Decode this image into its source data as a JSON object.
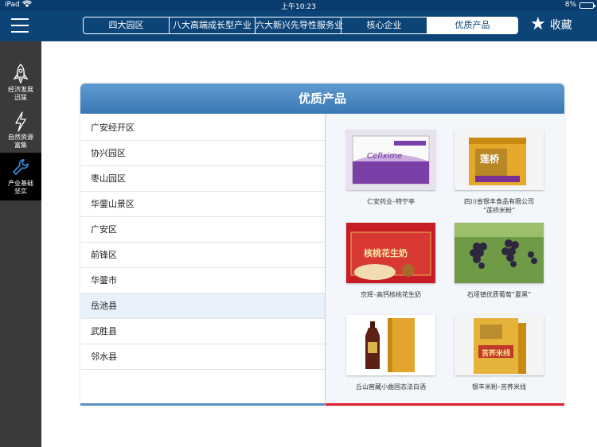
{
  "status_bar": {
    "carrier": "iPad",
    "time": "上午10:23",
    "battery": "8%"
  },
  "nav": {
    "tabs": [
      "四大园区",
      "八大高端成长型产业",
      "六大新兴先导性服务业",
      "核心企业",
      "优质产品"
    ],
    "active_tab": "优质产品",
    "favorite_label": "收藏"
  },
  "sidebar": {
    "items": [
      {
        "label_line1": "经济发展",
        "label_line2": "迅猛",
        "icon": "rocket-icon"
      },
      {
        "label_line1": "自然资源",
        "label_line2": "富集",
        "icon": "lightning-icon"
      },
      {
        "label_line1": "产业基础",
        "label_line2": "坚实",
        "icon": "wrench-icon"
      }
    ]
  },
  "card": {
    "title": "优质产品",
    "regions": [
      "广安经开区",
      "协兴园区",
      "枣山园区",
      "华蓥山景区",
      "广安区",
      "前锋区",
      "华蓥市",
      "岳池县",
      "武胜县",
      "邻水县"
    ],
    "selected_region": "岳池县",
    "products": [
      {
        "caption_line1": "仁安药业–特宁亭",
        "caption_line2": "",
        "box_text": "Cefixime"
      },
      {
        "caption_line1": "四川省银丰食品有限公司",
        "caption_line2": "“莲桥米粉”",
        "box_text": "莲桥"
      },
      {
        "caption_line1": "京辉–高钙核桃花生奶",
        "caption_line2": "",
        "box_text": "核桃花生奶"
      },
      {
        "caption_line1": "石垭镇优质葡萄“夏黑”",
        "caption_line2": "",
        "box_text": ""
      },
      {
        "caption_line1": "丘山窖藏小曲固态法白酒",
        "caption_line2": "",
        "box_text": ""
      },
      {
        "caption_line1": "银丰米粉–苦荞米线",
        "caption_line2": "",
        "box_text": "苦荞米线"
      }
    ]
  },
  "colors": {
    "navbar": "#0d4478",
    "header": "#3a78b5",
    "accent_red": "#d81f2a",
    "sidebar": "#3a3a3a"
  }
}
